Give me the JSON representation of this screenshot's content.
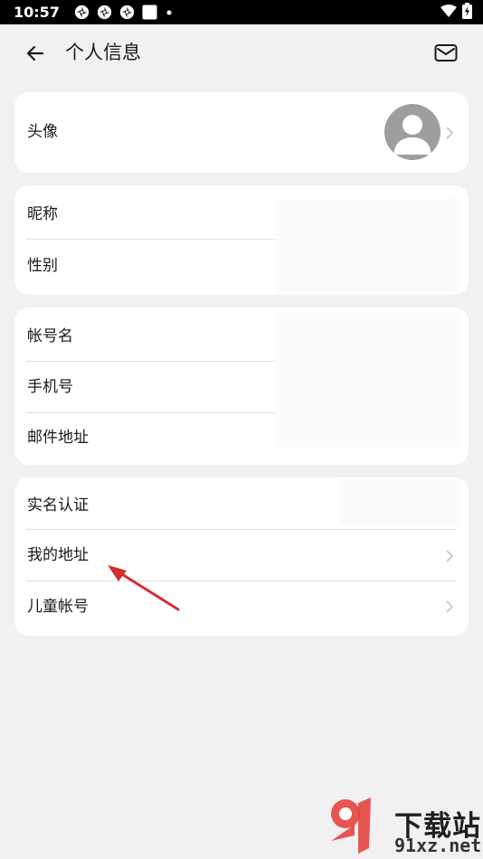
{
  "status_bar": {
    "time": "10:57",
    "icons": [
      "pinwheel-icon",
      "pinwheel-icon",
      "pinwheel-icon",
      "square-icon",
      "dot-icon"
    ],
    "right_icons": [
      "wifi-icon",
      "battery-icon"
    ]
  },
  "header": {
    "title": "个人信息",
    "back_icon": "arrow-left-icon",
    "mail_icon": "mail-icon"
  },
  "avatar_card": {
    "label": "头像"
  },
  "card_profile": {
    "items": [
      {
        "label": "昵称"
      },
      {
        "label": "性别"
      }
    ]
  },
  "card_account": {
    "items": [
      {
        "label": "帐号名"
      },
      {
        "label": "手机号"
      },
      {
        "label": "邮件地址"
      }
    ]
  },
  "card_other": {
    "items": [
      {
        "label": "实名认证"
      },
      {
        "label": "我的地址"
      },
      {
        "label": "儿童帐号"
      }
    ]
  },
  "watermark": {
    "title": "下载站",
    "url": "91xz.net"
  },
  "colors": {
    "background": "#f1f1f3",
    "card": "#ffffff",
    "annotation_arrow": "#d32f2f",
    "watermark_red": "#e53935"
  }
}
